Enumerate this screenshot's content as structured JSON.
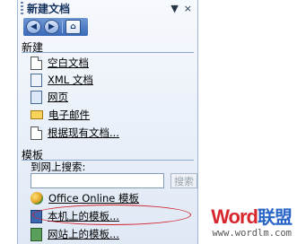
{
  "pane": {
    "title": "新建文档",
    "menu_glyph": "▼",
    "close_glyph": "×"
  },
  "nav": {
    "back_glyph": "◀",
    "forward_glyph": "▶",
    "home_glyph": "⌂"
  },
  "new_section": {
    "heading": "新建",
    "items": [
      {
        "label": "空白文档",
        "icon": "blank-document-icon"
      },
      {
        "label": "XML 文档",
        "icon": "xml-document-icon"
      },
      {
        "label": "网页",
        "icon": "web-page-icon"
      },
      {
        "label": "电子邮件",
        "icon": "email-icon"
      },
      {
        "label": "根据现有文档...",
        "icon": "existing-document-icon"
      }
    ]
  },
  "templates_section": {
    "heading": "模板",
    "search_label": "到网上搜索:",
    "search_value": "",
    "search_button": "搜索",
    "items": [
      {
        "label": "Office Online 模板",
        "icon": "office-online-icon"
      },
      {
        "label": "本机上的模板...",
        "icon": "local-templates-icon"
      },
      {
        "label": "网站上的模板...",
        "icon": "website-templates-icon"
      }
    ]
  },
  "highlight_color": "#d0202a",
  "watermark": {
    "brand_latin": "Word",
    "brand_cn": "联盟",
    "url": "www.wordlm.com"
  }
}
